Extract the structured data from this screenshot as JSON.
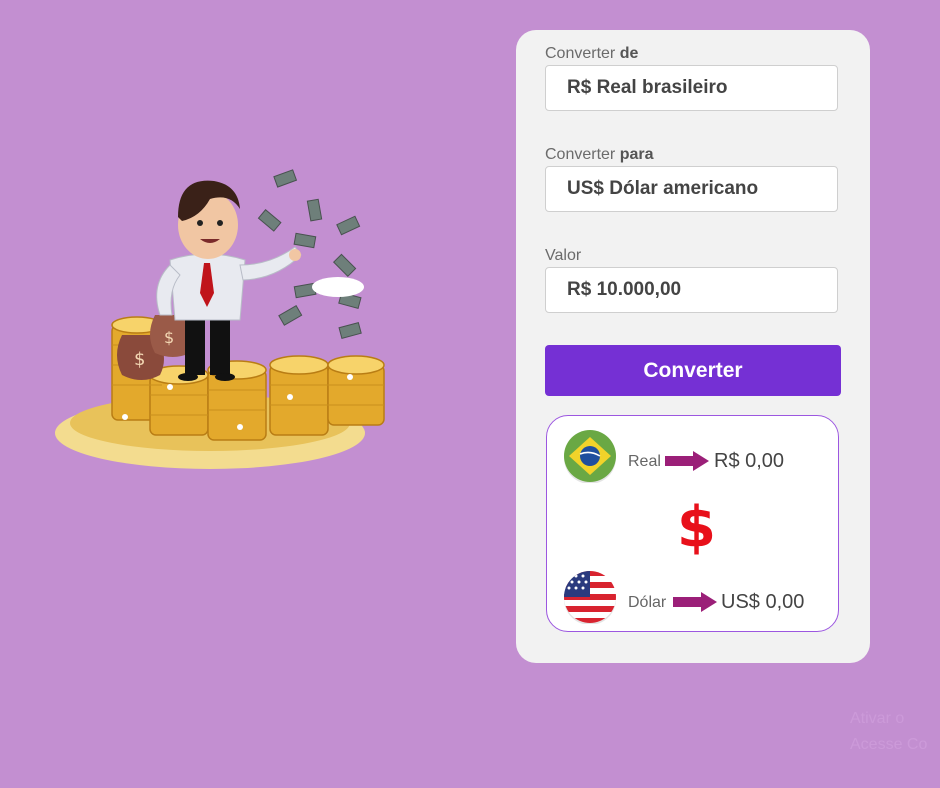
{
  "form": {
    "from_label_prefix": "Converter",
    "from_label_bold": "de",
    "from_value": "R$ Real brasileiro",
    "to_label_prefix": "Converter",
    "to_label_bold": "para",
    "to_value": "US$ Dólar americano",
    "amount_label": "Valor",
    "amount_value": "R$ 10.000,00",
    "convert_button": "Converter"
  },
  "result": {
    "from_currency_label": "Real",
    "from_result": "R$ 0,00",
    "symbol": "$",
    "to_currency_label": "Dólar",
    "to_result": "US$ 0,00"
  },
  "icons": {
    "illustration": "businessman-with-coins-illustration",
    "from_flag": "brazil-flag-icon",
    "to_flag": "usa-flag-icon",
    "arrow": "arrow-right-icon"
  },
  "colors": {
    "background": "#c38fd1",
    "card": "#f2f2f2",
    "accent": "#7530d4",
    "result_border": "#9c57e0",
    "symbol": "#e8101a",
    "arrow": "#9b1f78"
  },
  "watermark": {
    "line1": "Ativar o",
    "line2": "Acesse Co"
  }
}
